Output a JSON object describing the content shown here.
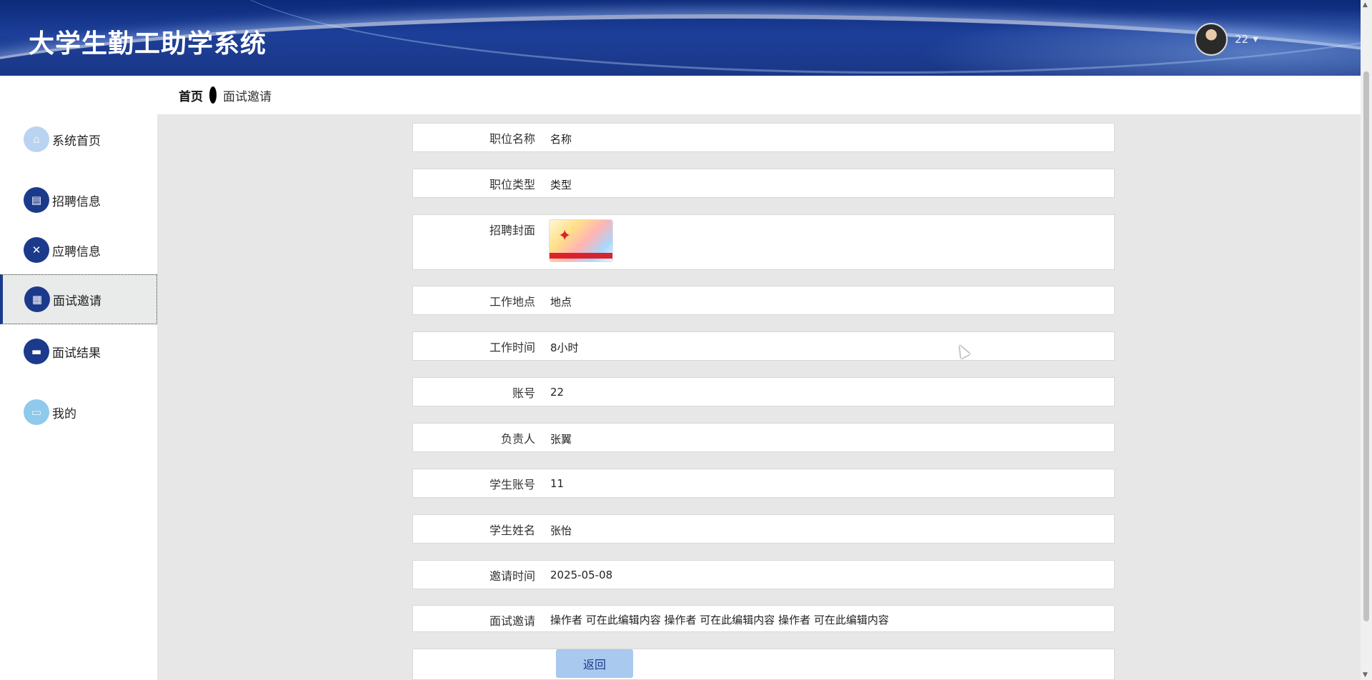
{
  "app": {
    "title": "大学生勤工助学系统"
  },
  "user": {
    "name": "22"
  },
  "breadcrumb": {
    "home": "首页",
    "current": "面试邀请"
  },
  "sidebar": {
    "items": [
      {
        "label": "系统首页",
        "icon": "home-icon"
      },
      {
        "label": "招聘信息",
        "icon": "clipboard-icon"
      },
      {
        "label": "应聘信息",
        "icon": "clipboard-x-icon"
      },
      {
        "label": "面试邀请",
        "icon": "grid-icon",
        "active": true
      },
      {
        "label": "面试结果",
        "icon": "briefcase-icon"
      },
      {
        "label": "我的",
        "icon": "card-icon"
      }
    ]
  },
  "form": {
    "fields": [
      {
        "label": "职位名称",
        "value": "名称"
      },
      {
        "label": "职位类型",
        "value": "类型"
      },
      {
        "label": "招聘封面",
        "value": ""
      },
      {
        "label": "工作地点",
        "value": "地点"
      },
      {
        "label": "工作时间",
        "value": "8小时"
      },
      {
        "label": "账号",
        "value": "22"
      },
      {
        "label": "负责人",
        "value": "张翼"
      },
      {
        "label": "学生账号",
        "value": "11"
      },
      {
        "label": "学生姓名",
        "value": "张怡"
      },
      {
        "label": "邀请时间",
        "value": "2025-05-08"
      },
      {
        "label": "面试邀请",
        "value": "操作者 可在此编辑内容 操作者 可在此编辑内容 操作者 可在此编辑内容"
      }
    ],
    "back_label": "返回"
  },
  "colors": {
    "primary": "#1c3a8c",
    "header": "#1d3f99",
    "content_bg": "#e7e7e7",
    "button": "#a9c9ee"
  }
}
